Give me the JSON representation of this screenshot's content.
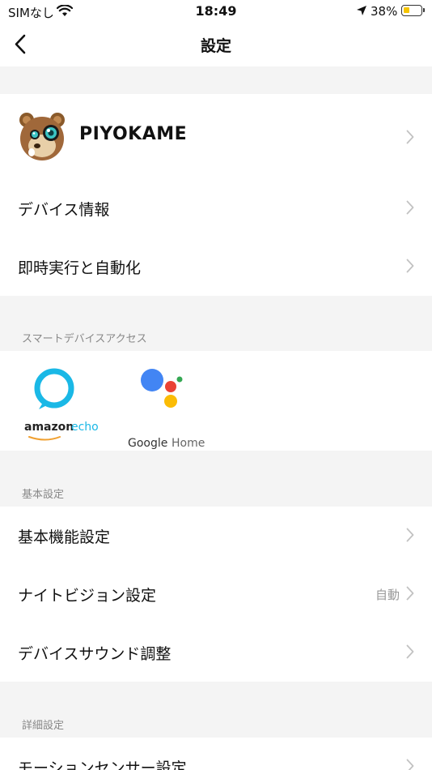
{
  "status_bar": {
    "carrier": "SIMなし",
    "time": "18:49",
    "battery": "38%",
    "battery_level": 0.38
  },
  "nav": {
    "title": "設定"
  },
  "device": {
    "name": "PIYOKAME"
  },
  "rows_top": [
    {
      "label": "デバイス情報"
    },
    {
      "label": "即時実行と自動化"
    }
  ],
  "smart_access": {
    "header": "スマートデバイスアクセス",
    "amazon": {
      "word1": "amazon",
      "word2": "echo"
    },
    "google": {
      "word1": "Google",
      "word2": "Home"
    }
  },
  "basic": {
    "header": "基本設定",
    "items": [
      {
        "label": "基本機能設定"
      },
      {
        "label": "ナイトビジョン設定",
        "value": "自動"
      },
      {
        "label": "デバイスサウンド調整"
      }
    ]
  },
  "detail": {
    "header": "詳細設定",
    "items": [
      {
        "label": "モーションセンサー設定"
      }
    ]
  },
  "colors": {
    "alexa": "#1ab8e6",
    "google_blue": "#4285f4",
    "google_red": "#ea4335",
    "google_yellow": "#fbbc05",
    "google_green": "#34a853",
    "battery": "#f5c400"
  },
  "icons": {
    "back": "chevron-left-icon",
    "row_arrow": "chevron-right-icon",
    "wifi": "wifi-icon",
    "location": "location-arrow-icon",
    "battery": "battery-icon"
  }
}
